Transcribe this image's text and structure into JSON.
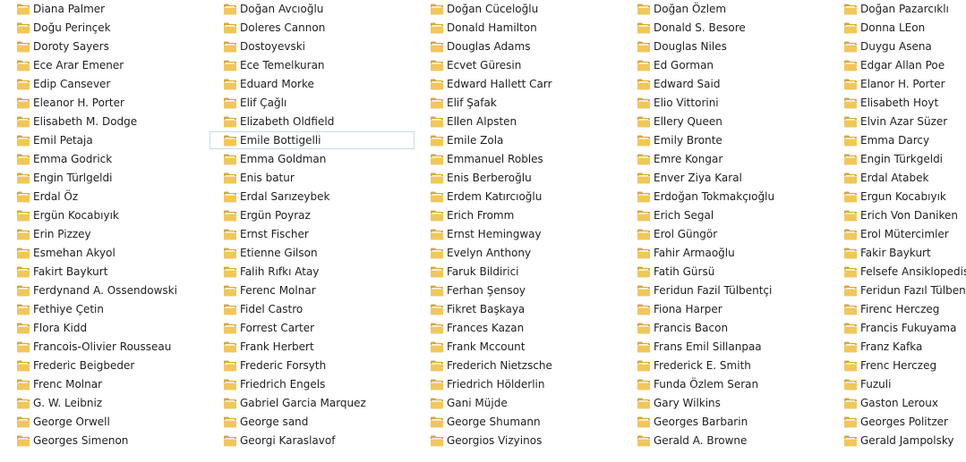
{
  "colors": {
    "folder_back": "#d9a53a",
    "folder_front": "#f1c75a",
    "folder_paper": "#fbf7e9",
    "selection_border": "#c5dbef"
  },
  "selected_item": "Emile Bottigelli",
  "columns": [
    [
      "Diana Palmer",
      "Doğu Perinçek",
      "Doroty Sayers",
      "Ece Arar Emener",
      "Edip Cansever",
      "Eleanor H. Porter",
      "Elisabeth M. Dodge",
      "Emil Petaja",
      "Emma Godrick",
      "Engin Türlgeldi",
      "Erdal Öz",
      "Ergün Kocabıyık",
      "Erin Pizzey",
      "Esmehan Akyol",
      "Fakirt Baykurt",
      "Ferdynand A. Ossendowski",
      "Fethiye Çetin",
      "Flora Kidd",
      "Francois-Olivier Rousseau",
      "Frederic Beigbeder",
      "Frenc Molnar",
      "G. W. Leibniz",
      "George Orwell",
      "Georges Simenon"
    ],
    [
      "Doğan Avcıoğlu",
      "Doleres Cannon",
      "Dostoyevski",
      "Ece Temelkuran",
      "Eduard Morke",
      "Elif Çağlı",
      "Elizabeth Oldfield",
      "Emile Bottigelli",
      "Emma Goldman",
      "Enis batur",
      "Erdal Sarızeybek",
      "Ergün Poyraz",
      "Ernst Fischer",
      "Etienne Gilson",
      "Falih Rıfkı Atay",
      "Ferenc Molnar",
      "Fidel Castro",
      "Forrest Carter",
      "Frank Herbert",
      "Frederic Forsyth",
      "Friedrich Engels",
      "Gabriel Garcia Marquez",
      "George sand",
      "Georgi Karaslavof"
    ],
    [
      "Doğan Cüceloğlu",
      "Donald Hamilton",
      "Douglas Adams",
      "Ecvet Güresin",
      "Edward Hallett Carr",
      "Elif Şafak",
      "Ellen Alpsten",
      "Emile Zola",
      "Emmanuel Robles",
      "Enis Berberoğlu",
      "Erdem Katırcıoğlu",
      "Erich Fromm",
      "Ernst Hemingway",
      "Evelyn Anthony",
      "Faruk Bildirici",
      "Ferhan Şensoy",
      "Fikret Başkaya",
      "Frances Kazan",
      "Frank Mccount",
      "Frederich Nietzsche",
      "Friedrich Hölderlin",
      "Gani Müjde",
      "George Shumann",
      "Georgios Vizyinos"
    ],
    [
      "Doğan Özlem",
      "Donald S. Besore",
      "Douglas Niles",
      "Ed Gorman",
      "Edward Said",
      "Elio Vittorini",
      "Ellery Queen",
      "Emily Bronte",
      "Emre Kongar",
      "Enver Ziya Karal",
      "Erdoğan Tokmakçıoğlu",
      "Erich Segal",
      "Erol Güngör",
      "Fahir Armaoğlu",
      "Fatih Gürsü",
      "Feridun Fazil Tülbentçi",
      "Fiona Harper",
      "Francis Bacon",
      "Frans Emil Sillanpaa",
      "Frederick E. Smith",
      "Funda Özlem Seran",
      "Gary Wilkins",
      "Georges Barbarin",
      "Gerald A. Browne"
    ],
    [
      "Doğan Pazarcıklı",
      "Donna LEon",
      "Duygu Asena",
      "Edgar Allan Poe",
      "Elanor H. Porter",
      "Elisabeth Hoyt",
      "Elvin Azar Süzer",
      "Emma Darcy",
      "Engin Türkgeldi",
      "Erdal Atabek",
      "Ergun Kocabıyık",
      "Erich Von Daniken",
      "Erol Mütercimler",
      "Fakir Baykurt",
      "Felsefe Ansiklopedisi",
      "Feridun Fazıl Tülbentçi",
      "Firenc Herczeg",
      "Francis Fukuyama",
      "Franz Kafka",
      "Frenc Herczeg",
      "Fuzuli",
      "Gaston Leroux",
      "Georges Politzer",
      "Gerald Jampolsky"
    ]
  ]
}
